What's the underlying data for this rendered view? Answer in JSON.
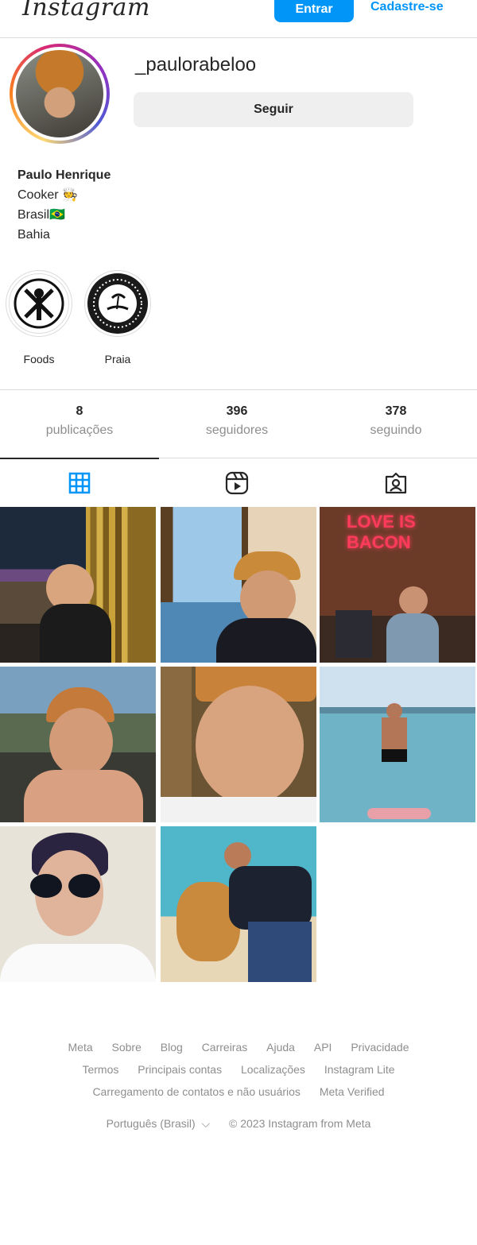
{
  "header": {
    "logo": "Instagram",
    "login_label": "Entrar",
    "signup_label": "Cadastre-se",
    "accent_color": "#0095f6"
  },
  "profile": {
    "username": "_paulorabeloo",
    "follow_label": "Seguir",
    "full_name": "Paulo Henrique",
    "bio_lines": [
      "Cooker 🧑‍🍳",
      "Brasil🇧🇷",
      "Bahia"
    ]
  },
  "highlights": [
    {
      "label": "Foods",
      "icon": "fork-knife-icon"
    },
    {
      "label": "Praia",
      "icon": "beach-icon"
    }
  ],
  "stats": [
    {
      "value": "8",
      "label": "publicações"
    },
    {
      "value": "396",
      "label": "seguidores"
    },
    {
      "value": "378",
      "label": "seguindo"
    }
  ],
  "tabs": [
    {
      "name": "posts",
      "icon": "grid-icon",
      "active": true
    },
    {
      "name": "reels",
      "icon": "reels-icon",
      "active": false
    },
    {
      "name": "tagged",
      "icon": "tagged-icon",
      "active": false
    }
  ],
  "posts": [
    {
      "neon_text": ""
    },
    {
      "neon_text": ""
    },
    {
      "neon_text": "LOVE IS BACON"
    },
    {
      "neon_text": ""
    },
    {
      "neon_text": ""
    },
    {
      "neon_text": ""
    },
    {
      "neon_text": ""
    },
    {
      "neon_text": ""
    }
  ],
  "footer": {
    "row1": [
      "Meta",
      "Sobre",
      "Blog",
      "Carreiras",
      "Ajuda",
      "API",
      "Privacidade"
    ],
    "row2": [
      "Termos",
      "Principais contas",
      "Localizações",
      "Instagram Lite"
    ],
    "row3": [
      "Carregamento de contatos e não usuários",
      "Meta Verified"
    ],
    "language": "Português (Brasil)",
    "copyright": "© 2023 Instagram from Meta"
  }
}
